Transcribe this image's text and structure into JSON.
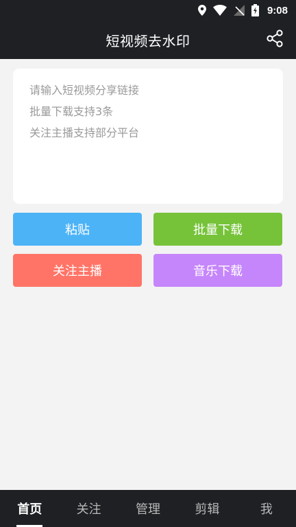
{
  "status_bar": {
    "time": "9:08",
    "icons": [
      "location-icon",
      "wifi-icon",
      "signal-off-icon",
      "battery-charging-icon"
    ]
  },
  "app_bar": {
    "title": "短视频去水印",
    "share_icon": "share-icon"
  },
  "link_input": {
    "placeholder": "请输入短视频分享链接\n批量下载支持3条\n关注主播支持部分平台",
    "value": ""
  },
  "actions": {
    "paste": "粘贴",
    "batch_download": "批量下载",
    "follow_streamer": "关注主播",
    "music_download": "音乐下载"
  },
  "colors": {
    "paste": "#4db3f7",
    "batch_download": "#76c33a",
    "follow_streamer": "#ff7467",
    "music_download": "#c686fb",
    "bar_background": "#1f2024"
  },
  "bottom_nav": {
    "items": [
      {
        "label": "首页",
        "active": true
      },
      {
        "label": "关注",
        "active": false
      },
      {
        "label": "管理",
        "active": false
      },
      {
        "label": "剪辑",
        "active": false
      },
      {
        "label": "我",
        "active": false
      }
    ]
  }
}
